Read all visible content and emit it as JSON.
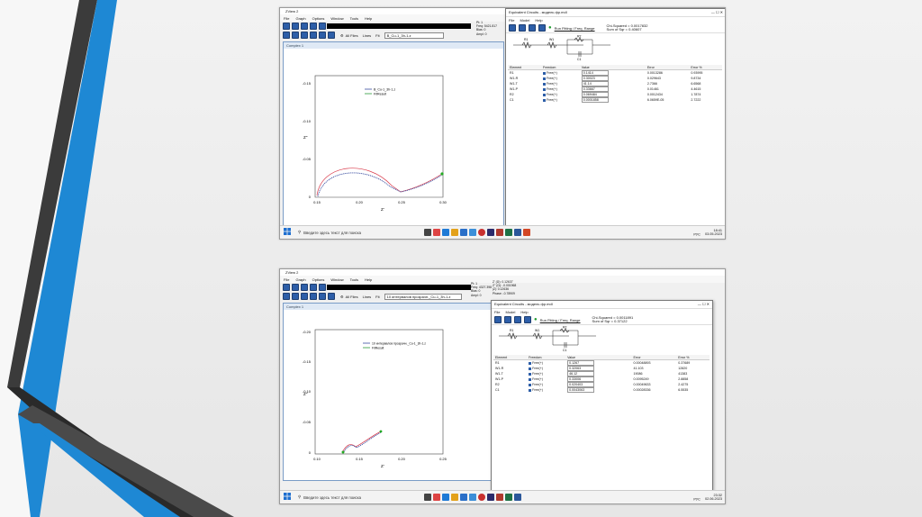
{
  "colors": {
    "dark_stripe": "#3d3d3d",
    "blue_stripe": "#1f8ad6",
    "measured": "#3a4ea0",
    "fit": "#d93a4a",
    "fit_end": "#22aa22"
  },
  "screens": [
    {
      "app_title": "ZView 2",
      "menu": [
        "File",
        "Graph",
        "Options",
        "Window",
        "Tools",
        "Help"
      ],
      "filter_label": "All Files",
      "lines_label": "Lines",
      "fit_label": "Fit",
      "file_combo": "B_Cu-1_3h-1.z",
      "readout_right": "Pt: 1\nFreq: 5421.817\nBias: 0\nAmpl: 0",
      "readout_freq": "Frequency (Hz): 5421.8\nZ': 0.14307\nZ'': -0.001488",
      "graph_title": "Complex 1",
      "legend": [
        "B_Cu-1_3h-1.z",
        "FitResult"
      ],
      "y_ticks": [
        "-0.15",
        "-0.10",
        "-0.05",
        "0"
      ],
      "x_ticks": [
        "0.15",
        "0.20",
        "0.25",
        "0.30"
      ],
      "ylabel": "Z''",
      "xlabel": "Z'",
      "eq_title": "Equivalent Circuits - модель фр.mdl",
      "eq_menu": [
        "File",
        "Model",
        "Help"
      ],
      "run_label": "Run Fitting / Freq. Range",
      "chi": "Chi-Squared = 0.0017832",
      "sum_sqr": "Sum of Sqr = 0.40607",
      "circuit_labels": [
        "R1",
        "W1",
        "R2",
        "C1"
      ],
      "param_headers": [
        "Element",
        "Freedom",
        "Value",
        "Error",
        "Error %"
      ],
      "params": [
        [
          "R1",
          "Free(+)",
          "0.1414",
          "0.0013286",
          "0.93995"
        ],
        [
          "W1-R",
          "Free(+)",
          "0.30023",
          "0.029643",
          "9.8734"
        ],
        [
          "W1-T",
          "Free(+)",
          "41.14",
          "2.7366",
          "6.6568"
        ],
        [
          "W1-P",
          "Free(+)",
          "0.33667",
          "0.01461",
          "4.4615"
        ],
        [
          "R2",
          "Free(+)",
          "0.069484",
          "0.0012434",
          "1.7874"
        ],
        [
          "C1",
          "Free(+)",
          "0.0001858",
          "6.0659E-05",
          "2.7222"
        ]
      ],
      "taskbar_search": "Введите здесь текст для поиска",
      "tray_lang": "РУС",
      "tray_time": "18:41",
      "tray_date": "03.05.2023"
    },
    {
      "app_title": "ZView 2",
      "menu": [
        "File",
        "Graph",
        "Options",
        "Window",
        "Tools",
        "Help"
      ],
      "filter_label": "All Files",
      "lines_label": "Lines",
      "fit_label": "Fit",
      "file_combo": "10 интервалов прозрачн._Cu-1_3h-1.z",
      "readout_right": "Pt: 1\nFreq: 4327.398\nBias: 0\nAmpl: 0",
      "readout_freq": "Frequency (Hz): 4327.1\nZ': 0.12637\nZ'': -0.001968",
      "readout_top": "Z' (Ω): 0.12637\nZ'' (Ω): -0.001968\n|Z|: 0.12636\nPhase: -0.78909",
      "graph_title": "Complex 1",
      "legend": [
        "10 интервалов прозрачн._Cu-1_3h-1.z",
        "FitResult"
      ],
      "y_ticks": [
        "-0.20",
        "-0.15",
        "-0.10",
        "-0.05",
        "0"
      ],
      "x_ticks": [
        "0.10",
        "0.15",
        "0.20",
        "0.25"
      ],
      "ylabel": "Z''",
      "xlabel": "Z'",
      "eq_title": "Equivalent Circuits - модель фр.mdl",
      "eq_menu": [
        "File",
        "Model",
        "Help"
      ],
      "run_label": "Run Fitting / Freq. Range",
      "chi": "Chi-Squared = 0.0011891",
      "sum_sqr": "Sum of Sqr = 0.37122",
      "circuit_labels": [
        "R1",
        "W1",
        "R2",
        "C1"
      ],
      "param_headers": [
        "Element",
        "Freedom",
        "Value",
        "Error",
        "Error %"
      ],
      "params": [
        [
          "R1",
          "Free(+)",
          "0.1267",
          "0.00048893",
          "0.37689"
        ],
        [
          "W1-R",
          "Free(+)",
          "0.32063",
          "41.103",
          "12820"
        ],
        [
          "W1-T",
          "Free(+)",
          "46.12",
          "19086",
          "41383"
        ],
        [
          "W1-P",
          "Free(+)",
          "0.33006",
          "0.0095249",
          "2.8858"
        ],
        [
          "R2",
          "Free(+)",
          "0.020403",
          "0.00049633",
          "2.4275"
        ],
        [
          "C1",
          "Free(+)",
          "0.0043063",
          "0.00028336",
          "6.5535"
        ]
      ],
      "taskbar_search": "Введите здесь текст для поиска",
      "tray_lang": "РУС",
      "tray_time": "23:32",
      "tray_date": "02.06.2023"
    }
  ]
}
